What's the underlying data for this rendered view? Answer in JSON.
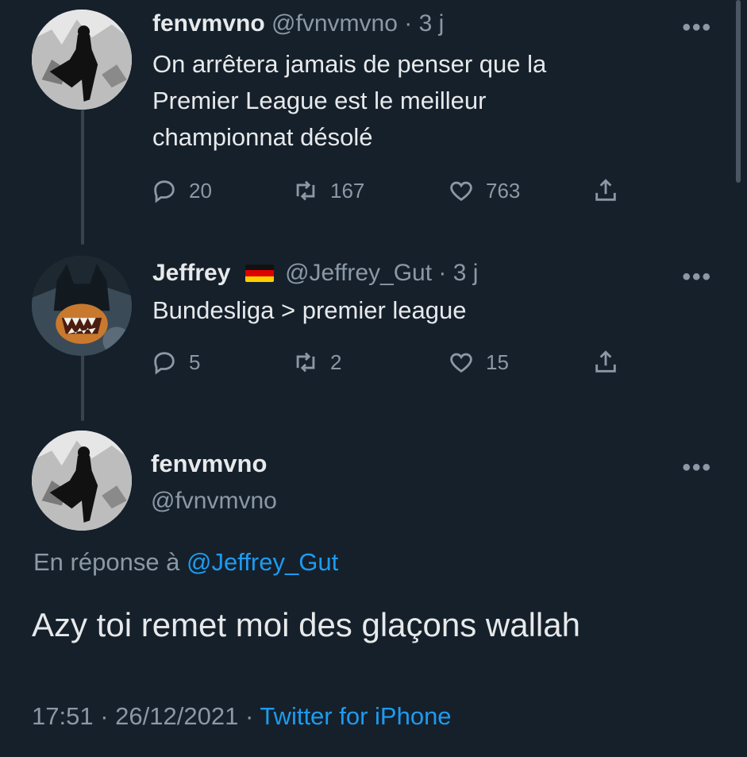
{
  "tweets": [
    {
      "name": "fenvmvno",
      "handle": "@fvnvmvno",
      "time": "3 j",
      "text_lines": [
        "On arrêtera jamais de penser que la",
        "Premier League est le meilleur",
        "championnat désolé"
      ],
      "replies": "20",
      "retweets": "167",
      "likes": "763"
    },
    {
      "name": "Jeffrey",
      "handle": "@Jeffrey_Gut",
      "time": "3 j",
      "text": "Bundesliga > premier league",
      "replies": "5",
      "retweets": "2",
      "likes": "15"
    }
  ],
  "main_tweet": {
    "name": "fenvmvno",
    "handle": "@fvnvmvno",
    "reply_prefix": "En réponse à",
    "reply_mention": "@Jeffrey_Gut",
    "text": "Azy toi remet moi des glaçons wallah",
    "time": "17:51",
    "date": "26/12/2021",
    "source": "Twitter for iPhone"
  },
  "ui": {
    "more_glyph": "•••",
    "separator": "·"
  },
  "colors": {
    "background": "#15202b",
    "text": "#e7e9ea",
    "muted": "#8b98a5",
    "link": "#1d9bf0",
    "thread_line": "#38444d"
  }
}
